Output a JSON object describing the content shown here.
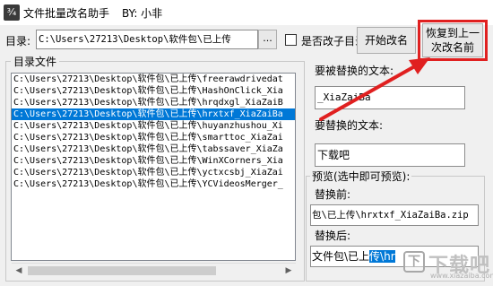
{
  "window": {
    "icon_glyph": "¾",
    "title": "文件批量改名助手",
    "author": "BY: 小非"
  },
  "toolbar": {
    "dir_label": "目录:",
    "dir_value": "C:\\Users\\27213\\Desktop\\软件包\\已上传",
    "browse_label": "...",
    "subdir_label": "是否改子目录",
    "subdir_checked": false,
    "start_label": "开始改名",
    "restore_label_line1": "恢复到上一",
    "restore_label_line2": "次改名前"
  },
  "file_group": {
    "title": "目录文件",
    "items": [
      "C:\\Users\\27213\\Desktop\\软件包\\已上传\\freerawdrivedat",
      "C:\\Users\\27213\\Desktop\\软件包\\已上传\\HashOnClick_Xia",
      "C:\\Users\\27213\\Desktop\\软件包\\已上传\\hrqdxgl_XiaZaiB",
      "C:\\Users\\27213\\Desktop\\软件包\\已上传\\hrxtxf_XiaZaiBa",
      "C:\\Users\\27213\\Desktop\\软件包\\已上传\\huyanzhushou_Xi",
      "C:\\Users\\27213\\Desktop\\软件包\\已上传\\smarttoc_XiaZai",
      "C:\\Users\\27213\\Desktop\\软件包\\已上传\\tabssaver_XiaZa",
      "C:\\Users\\27213\\Desktop\\软件包\\已上传\\WinXCorners_Xia",
      "C:\\Users\\27213\\Desktop\\软件包\\已上传\\yctxcsbj_XiaZai",
      "C:\\Users\\27213\\Desktop\\软件包\\已上传\\YCVideosMerger_"
    ],
    "selected_index": 3
  },
  "find": {
    "label": "要被替换的文本:",
    "value": "_XiaZaiBa"
  },
  "replace": {
    "label": "要替换的文本:",
    "value": "下载吧"
  },
  "preview": {
    "title": "预览(选中即可预览):",
    "before_label": "替换前:",
    "before_value": "包\\已上传\\hrxtxf_XiaZaiBa.zip",
    "after_label": "替换后:",
    "after_value": "文件包\\已上",
    "after_selected": "传\\hr"
  },
  "watermark": {
    "logo": "下",
    "text": "下载吧",
    "url": "www.xiazaiba.com"
  },
  "colors": {
    "highlight": "#e02020",
    "selection": "#0078d7"
  }
}
